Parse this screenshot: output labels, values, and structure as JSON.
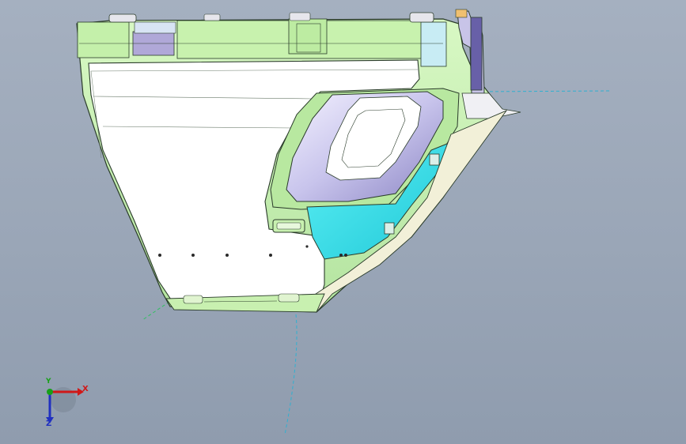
{
  "viewport": {
    "background_top": "#a5b0c0",
    "background_bottom": "#8f9cae"
  },
  "model": {
    "main_panel_color": "#ffffff",
    "frame_color": "#c8f0b0",
    "edge_color": "#2a3b2a",
    "bracket_color": "#40e0e8",
    "housing_color": "#c8c4e8",
    "pad_color": "#b0a8d8",
    "reference_line_color": "#30b0d0"
  },
  "triad": {
    "x_label": "X",
    "y_label": "Y",
    "z_label": "Z",
    "x_color": "#d01818",
    "y_color": "#18a018",
    "z_color": "#2030c0"
  }
}
